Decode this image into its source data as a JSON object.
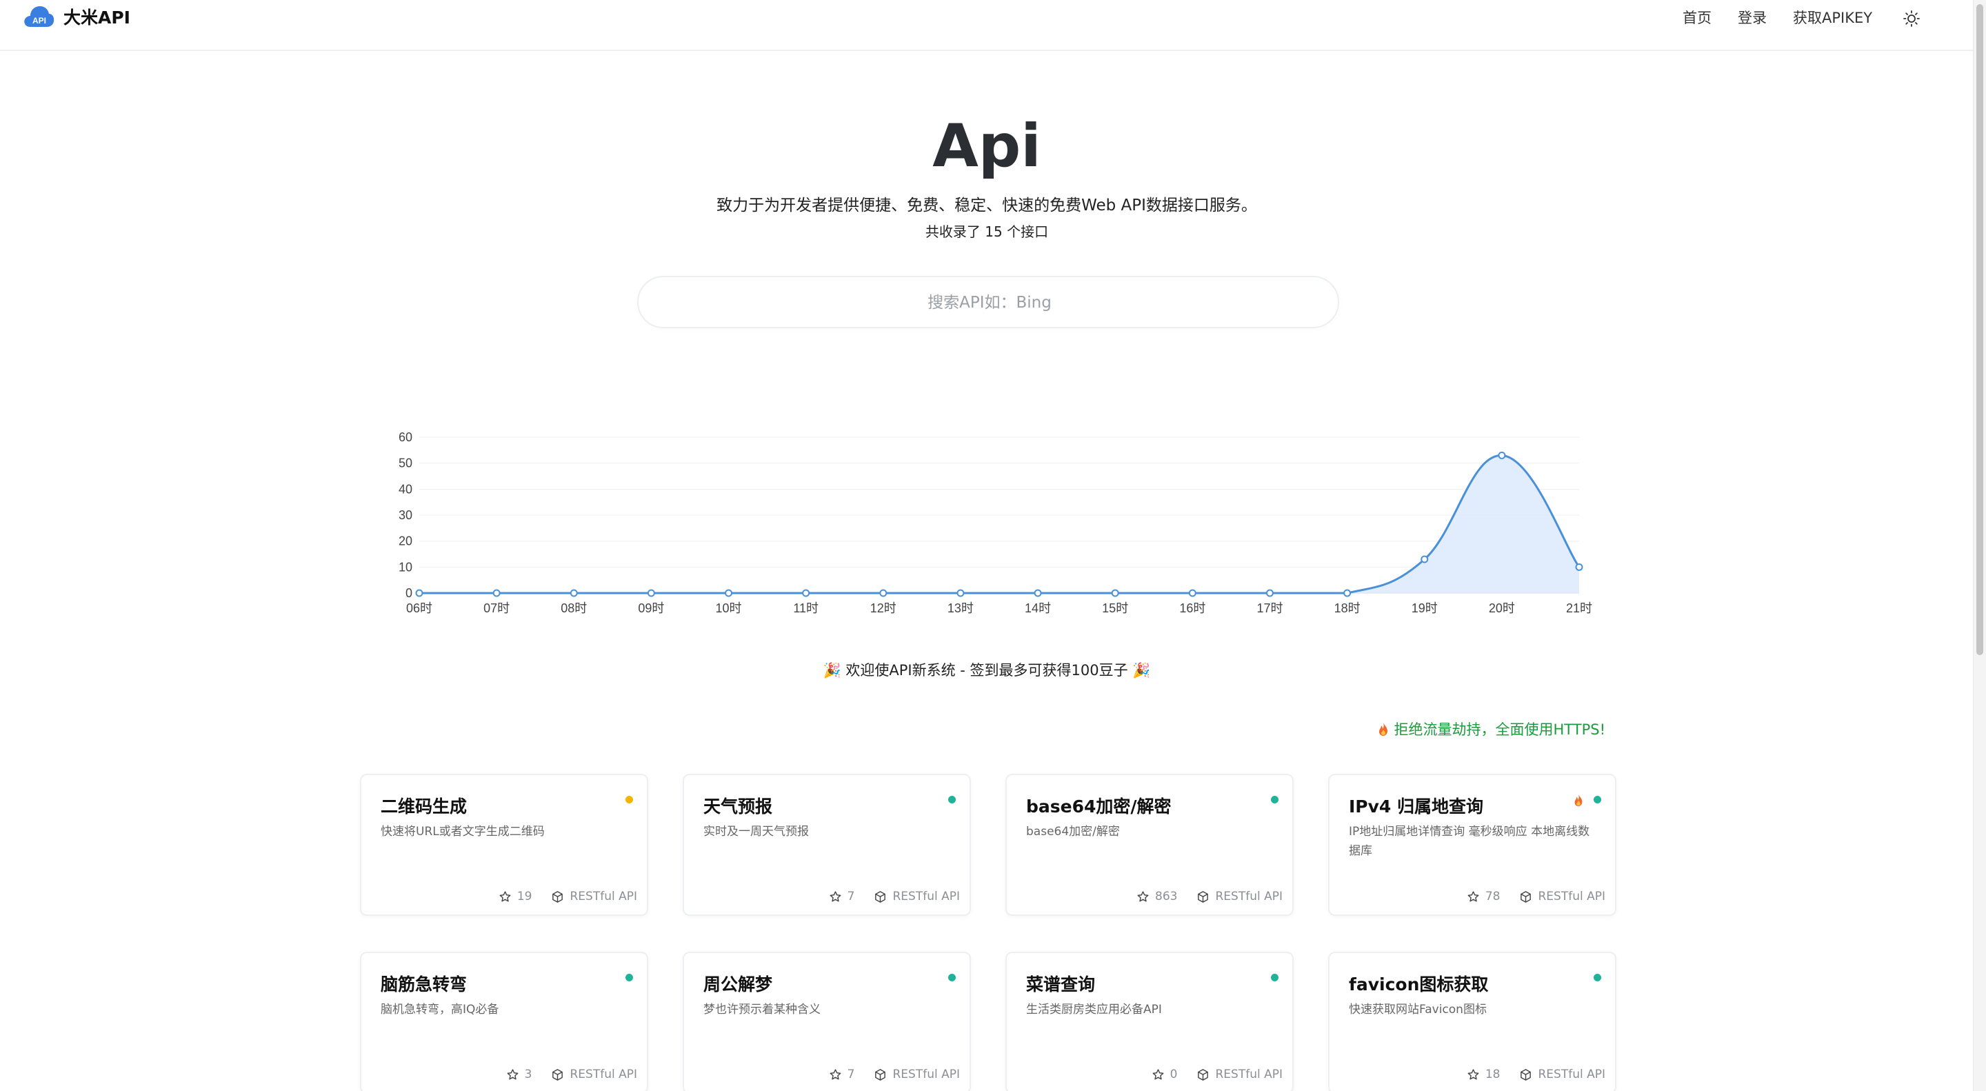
{
  "header": {
    "logo_badge": "API",
    "site_name": "大米API",
    "nav": [
      {
        "label": "首页"
      },
      {
        "label": "登录"
      },
      {
        "label": "获取APIKEY"
      }
    ]
  },
  "hero": {
    "title": "Api",
    "subtitle": "致力于为开发者提供便捷、免费、稳定、快速的免费Web API数据接口服务。",
    "count_text": "共收录了 15 个接口"
  },
  "search": {
    "placeholder": "搜索API如：Bing"
  },
  "chart_data": {
    "type": "area",
    "title": "",
    "xlabel": "",
    "ylabel": "",
    "categories": [
      "06时",
      "07时",
      "08时",
      "09时",
      "10时",
      "11时",
      "12时",
      "13时",
      "14时",
      "15时",
      "16时",
      "17时",
      "18时",
      "19时",
      "20时",
      "21时"
    ],
    "series": [
      {
        "values": [
          0,
          0,
          0,
          0,
          0,
          0,
          0,
          0,
          0,
          0,
          0,
          0,
          0,
          13,
          53,
          10
        ]
      }
    ],
    "ylim": [
      0,
      60
    ],
    "yticks": [
      0,
      10,
      20,
      30,
      40,
      50,
      60
    ],
    "grid": true,
    "line_color": "#4a90d9",
    "fill_color": "#dceafb"
  },
  "banner": {
    "text": "🎉 欢迎使API新系统 - 签到最多可获得100豆子 🎉"
  },
  "https_note": {
    "text": "拒绝流量劫持，全面使用HTTPS!",
    "color": "#1a9c3c"
  },
  "colors": {
    "status_green": "#1fb39a",
    "status_yellow": "#f4b400",
    "fire": "#f06a2b"
  },
  "cards": [
    {
      "title": "二维码生成",
      "desc": "快速将URL或者文字生成二维码",
      "stars": "19",
      "kind": "RESTful API",
      "status": "yellow",
      "hot": false
    },
    {
      "title": "天气预报",
      "desc": "实时及一周天气预报",
      "stars": "7",
      "kind": "RESTful API",
      "status": "green",
      "hot": false
    },
    {
      "title": "base64加密/解密",
      "desc": "base64加密/解密",
      "stars": "863",
      "kind": "RESTful API",
      "status": "green",
      "hot": false
    },
    {
      "title": "IPv4 归属地查询",
      "desc": "IP地址归属地详情查询 毫秒级响应 本地离线数据库",
      "stars": "78",
      "kind": "RESTful API",
      "status": "green",
      "hot": true
    },
    {
      "title": "脑筋急转弯",
      "desc": "脑机急转弯，高IQ必备",
      "stars": "3",
      "kind": "RESTful API",
      "status": "green",
      "hot": false
    },
    {
      "title": "周公解梦",
      "desc": "梦也许预示着某种含义",
      "stars": "7",
      "kind": "RESTful API",
      "status": "green",
      "hot": false
    },
    {
      "title": "菜谱查询",
      "desc": "生活类厨房类应用必备API",
      "stars": "0",
      "kind": "RESTful API",
      "status": "green",
      "hot": false
    },
    {
      "title": "favicon图标获取",
      "desc": "快速获取网站Favicon图标",
      "stars": "18",
      "kind": "RESTful API",
      "status": "green",
      "hot": false
    }
  ]
}
